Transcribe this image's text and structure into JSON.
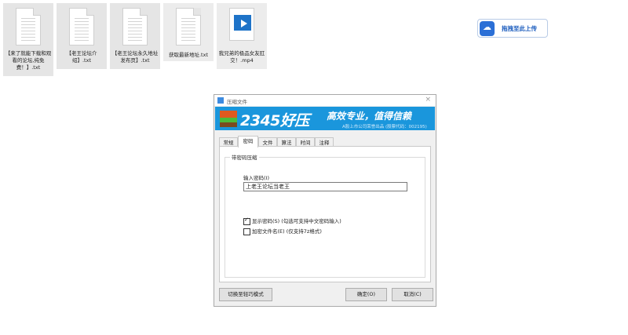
{
  "desktop": {
    "files": [
      {
        "label": "【来了就能下载和观看的论坛,纯免费！】.txt",
        "type": "txt"
      },
      {
        "label": "【老王论坛介绍】.txt",
        "type": "txt"
      },
      {
        "label": "【老王论坛永久地址发布页】.txt",
        "type": "txt"
      },
      {
        "label": "获取最新地址.txt",
        "type": "txt"
      },
      {
        "label": "我兄弟的极品女友肛交！.mp4",
        "type": "mp4"
      }
    ],
    "upload_button": {
      "label": "拖拽至此上传",
      "icon": "cloud-upload-icon"
    }
  },
  "dialog": {
    "title": "压缩文件",
    "close": "×",
    "banner": {
      "logo": "2345好压",
      "slogan": "高效专业，值得信赖",
      "subtitle": "A股上市公司荣誉出品 (股票代码：002195)"
    },
    "tabs": [
      {
        "label": "常规",
        "active": false
      },
      {
        "label": "密码",
        "active": true
      },
      {
        "label": "文件",
        "active": false
      },
      {
        "label": "算法",
        "active": false
      },
      {
        "label": "时间",
        "active": false
      },
      {
        "label": "注释",
        "active": false
      }
    ],
    "group_label": "带密码压缩",
    "password_label": "输入密码(I)",
    "password_value": "上老王论坛当老王",
    "show_password": {
      "label": "显示密码(S) (勾选可支持中文密码输入)",
      "checked": true
    },
    "encrypt_names": {
      "label": "加密文件名(E) (仅支持7z格式)",
      "checked": false
    },
    "buttons": {
      "mode": "切换至轻巧模式",
      "ok": "确定(O)",
      "cancel": "取消(C)"
    },
    "colors": {
      "banner": "#1a96dc",
      "accent": "#2b6fd6"
    }
  }
}
